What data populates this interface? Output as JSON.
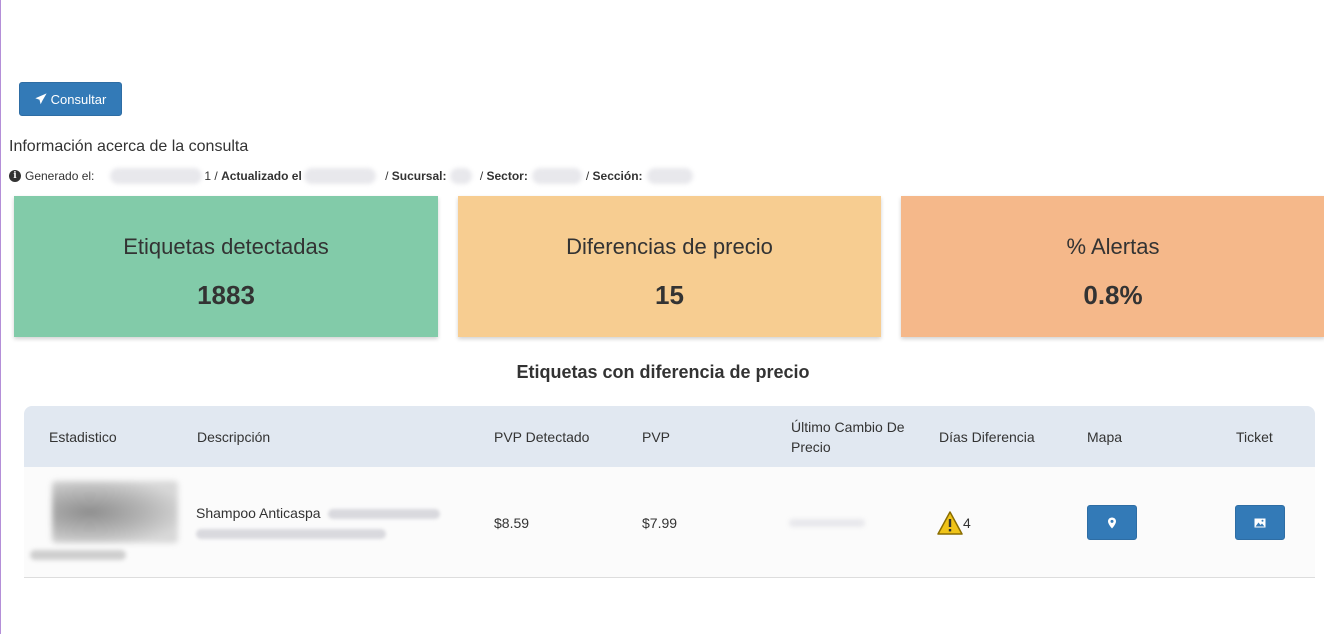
{
  "toolbar": {
    "consultar_label": "Consultar"
  },
  "info": {
    "title": "Información acerca de la consulta",
    "generado_label": "Generado el:",
    "generado_tail": "1",
    "actualizado_label": "Actualizado el",
    "actualizado_tail": "",
    "sucursal_label": "Sucursal:",
    "sector_label": "Sector:",
    "seccion_label": "Sección:"
  },
  "stats": [
    {
      "label": "Etiquetas detectadas",
      "value": "1883",
      "color": "#82cba9"
    },
    {
      "label": "Diferencias de precio",
      "value": "15",
      "color": "#f7cd91"
    },
    {
      "label": "% Alertas",
      "value": "0.8%",
      "color": "#f5b88a"
    }
  ],
  "table": {
    "title": "Etiquetas con diferencia de precio",
    "columns": [
      "Estadistico",
      "Descripción",
      "PVP Detectado",
      "PVP",
      "Último Cambio De Precio",
      "Días Diferencia",
      "Mapa",
      "Ticket"
    ],
    "rows": [
      {
        "descripcion": "Shampoo Anticaspa",
        "pvp_detectado": "$8.59",
        "pvp": "$7.99",
        "dias_diferencia": "4",
        "icons": {
          "dias": "warning-icon",
          "mapa": "map-marker-icon",
          "ticket": "image-icon"
        }
      }
    ]
  },
  "colors": {
    "primary": "#337ab7",
    "header_bg": "#e1e8f1",
    "warning": "#f0c419"
  }
}
